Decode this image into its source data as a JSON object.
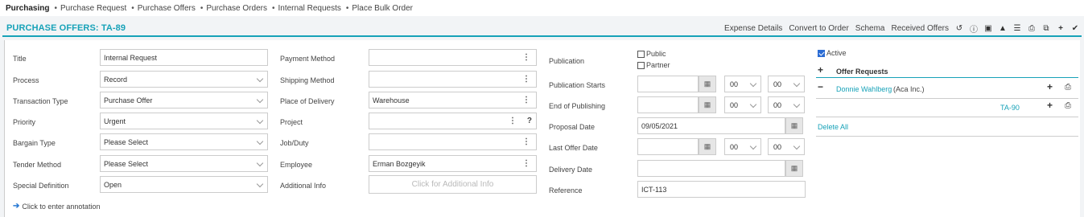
{
  "topnav": {
    "brand": "Purchasing",
    "items": [
      "Purchase Request",
      "Purchase Offers",
      "Purchase Orders",
      "Internal Requests",
      "Place Bulk Order"
    ]
  },
  "header": {
    "title": "PURCHASE OFFERS: TA-89",
    "actions": [
      "Expense Details",
      "Convert to Order",
      "Schema",
      "Received Offers"
    ],
    "icons": [
      "history-icon",
      "info-icon",
      "box-icon",
      "bell-icon",
      "list-icon",
      "print-icon",
      "copy-icon",
      "plus-icon",
      "check-icon"
    ]
  },
  "form": {
    "col1": {
      "title": {
        "label": "Title",
        "value": "Internal Request"
      },
      "process": {
        "label": "Process",
        "value": "Record"
      },
      "transaction_type": {
        "label": "Transaction Type",
        "value": "Purchase Offer"
      },
      "priority": {
        "label": "Priority",
        "value": "Urgent"
      },
      "bargain_type": {
        "label": "Bargain Type",
        "value": "Please Select"
      },
      "tender_method": {
        "label": "Tender Method",
        "value": "Please Select"
      },
      "special_definition": {
        "label": "Special Definition",
        "value": "Open"
      }
    },
    "col2": {
      "payment_method": {
        "label": "Payment Method",
        "value": ""
      },
      "shipping_method": {
        "label": "Shipping Method",
        "value": ""
      },
      "place_of_delivery": {
        "label": "Place of Delivery",
        "value": "Warehouse"
      },
      "project": {
        "label": "Project",
        "value": ""
      },
      "job_duty": {
        "label": "Job/Duty",
        "value": ""
      },
      "employee": {
        "label": "Employee",
        "value": "Erman Bozgeyik"
      },
      "additional_info": {
        "label": "Additional Info",
        "placeholder": "Click for Additional Info"
      }
    },
    "col3": {
      "publication": {
        "label": "Publication",
        "public": "Public",
        "partner": "Partner"
      },
      "publication_starts": {
        "label": "Publication Starts",
        "date": "",
        "hour": "00",
        "minute": "00"
      },
      "end_of_publishing": {
        "label": "End of Publishing",
        "date": "",
        "hour": "00",
        "minute": "00"
      },
      "proposal_date": {
        "label": "Proposal Date",
        "value": "09/05/2021"
      },
      "last_offer_date": {
        "label": "Last Offer Date",
        "date": "",
        "hour": "00",
        "minute": "00"
      },
      "delivery_date": {
        "label": "Delivery Date",
        "value": ""
      },
      "reference": {
        "label": "Reference",
        "value": "ICT-113"
      }
    },
    "annotation": "Click to enter annotation"
  },
  "right_panel": {
    "active_label": "Active",
    "active_checked": true,
    "offer_requests_title": "Offer Requests",
    "request": {
      "name": "Donnie Wahlberg",
      "company": "(Aca Inc.)",
      "code": "TA-90"
    },
    "delete_all": "Delete All"
  }
}
